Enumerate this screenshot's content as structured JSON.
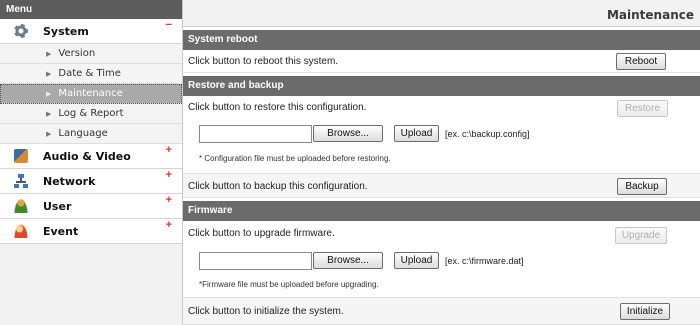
{
  "sidebar": {
    "header": "Menu",
    "categories": [
      {
        "label": "System",
        "marker": "−",
        "icon": "gear-icon"
      },
      {
        "label": "Audio & Video",
        "marker": "+",
        "icon": "audio-video-icon"
      },
      {
        "label": "Network",
        "marker": "+",
        "icon": "network-icon"
      },
      {
        "label": "User",
        "marker": "+",
        "icon": "user-icon"
      },
      {
        "label": "Event",
        "marker": "+",
        "icon": "event-icon"
      }
    ],
    "system_items": [
      {
        "label": "Version"
      },
      {
        "label": "Date & Time"
      },
      {
        "label": "Maintenance",
        "active": true
      },
      {
        "label": "Log & Report"
      },
      {
        "label": "Language"
      }
    ]
  },
  "main": {
    "title": "Maintenance",
    "reboot": {
      "section": "System reboot",
      "text": "Click button to reboot this system.",
      "button": "Reboot"
    },
    "restore": {
      "section": "Restore and backup",
      "text": "Click button to restore this configuration.",
      "button": "Restore",
      "browse": "Browse...",
      "upload": "Upload",
      "example": "[ex. c:\\backup.config]",
      "note": "* Configuration file must be uploaded before restoring."
    },
    "backup": {
      "text": "Click button to backup this configuration.",
      "button": "Backup"
    },
    "firmware": {
      "section": "Firmware",
      "text": "Click button to upgrade firmware.",
      "button": "Upgrade",
      "browse": "Browse...",
      "upload": "Upload",
      "example": "[ex. c:\\firmware.dat]",
      "note": "*Firmware file must be uploaded before upgrading."
    },
    "initialize": {
      "text": "Click button to initialize the system.",
      "button": "Initialize"
    }
  },
  "colors": {
    "section_bg": "#6b6b6b",
    "menu_header_bg": "#5d5d5d",
    "active_item_bg": "#a9a9a9",
    "marker": "#e0332b"
  }
}
